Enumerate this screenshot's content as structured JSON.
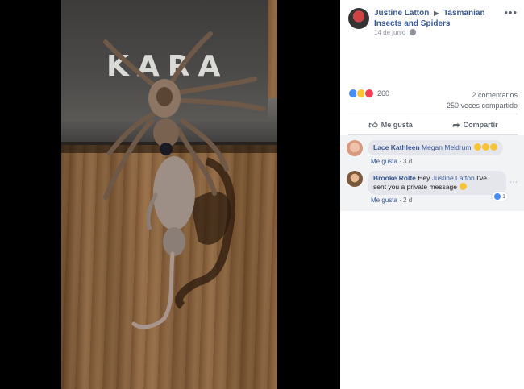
{
  "post": {
    "author": "Justine Latton",
    "group": "Tasmanian Insects and Spiders",
    "date": "14 de junio",
    "reaction_count": "260",
    "comments_count": "2 comentarios",
    "shares_count": "250 veces compartido",
    "like_label": "Me gusta",
    "share_label": "Compartir"
  },
  "photo": {
    "box_text": "KARA"
  },
  "comments": [
    {
      "author": "Lace Kathleen",
      "text": "Megan Meldrum",
      "like_label": "Me gusta",
      "time": "3 d"
    },
    {
      "author": "Brooke Rolfe",
      "text_before": "Hey ",
      "tag": "Justine Latton",
      "text_after": " I've sent you a private message",
      "like_label": "Me gusta",
      "time": "2 d",
      "reaction_count": "1"
    }
  ],
  "icons": {
    "globe": "globe-icon",
    "more": "more-icon",
    "like": "thumbs-up-icon",
    "share": "share-arrow-icon"
  }
}
